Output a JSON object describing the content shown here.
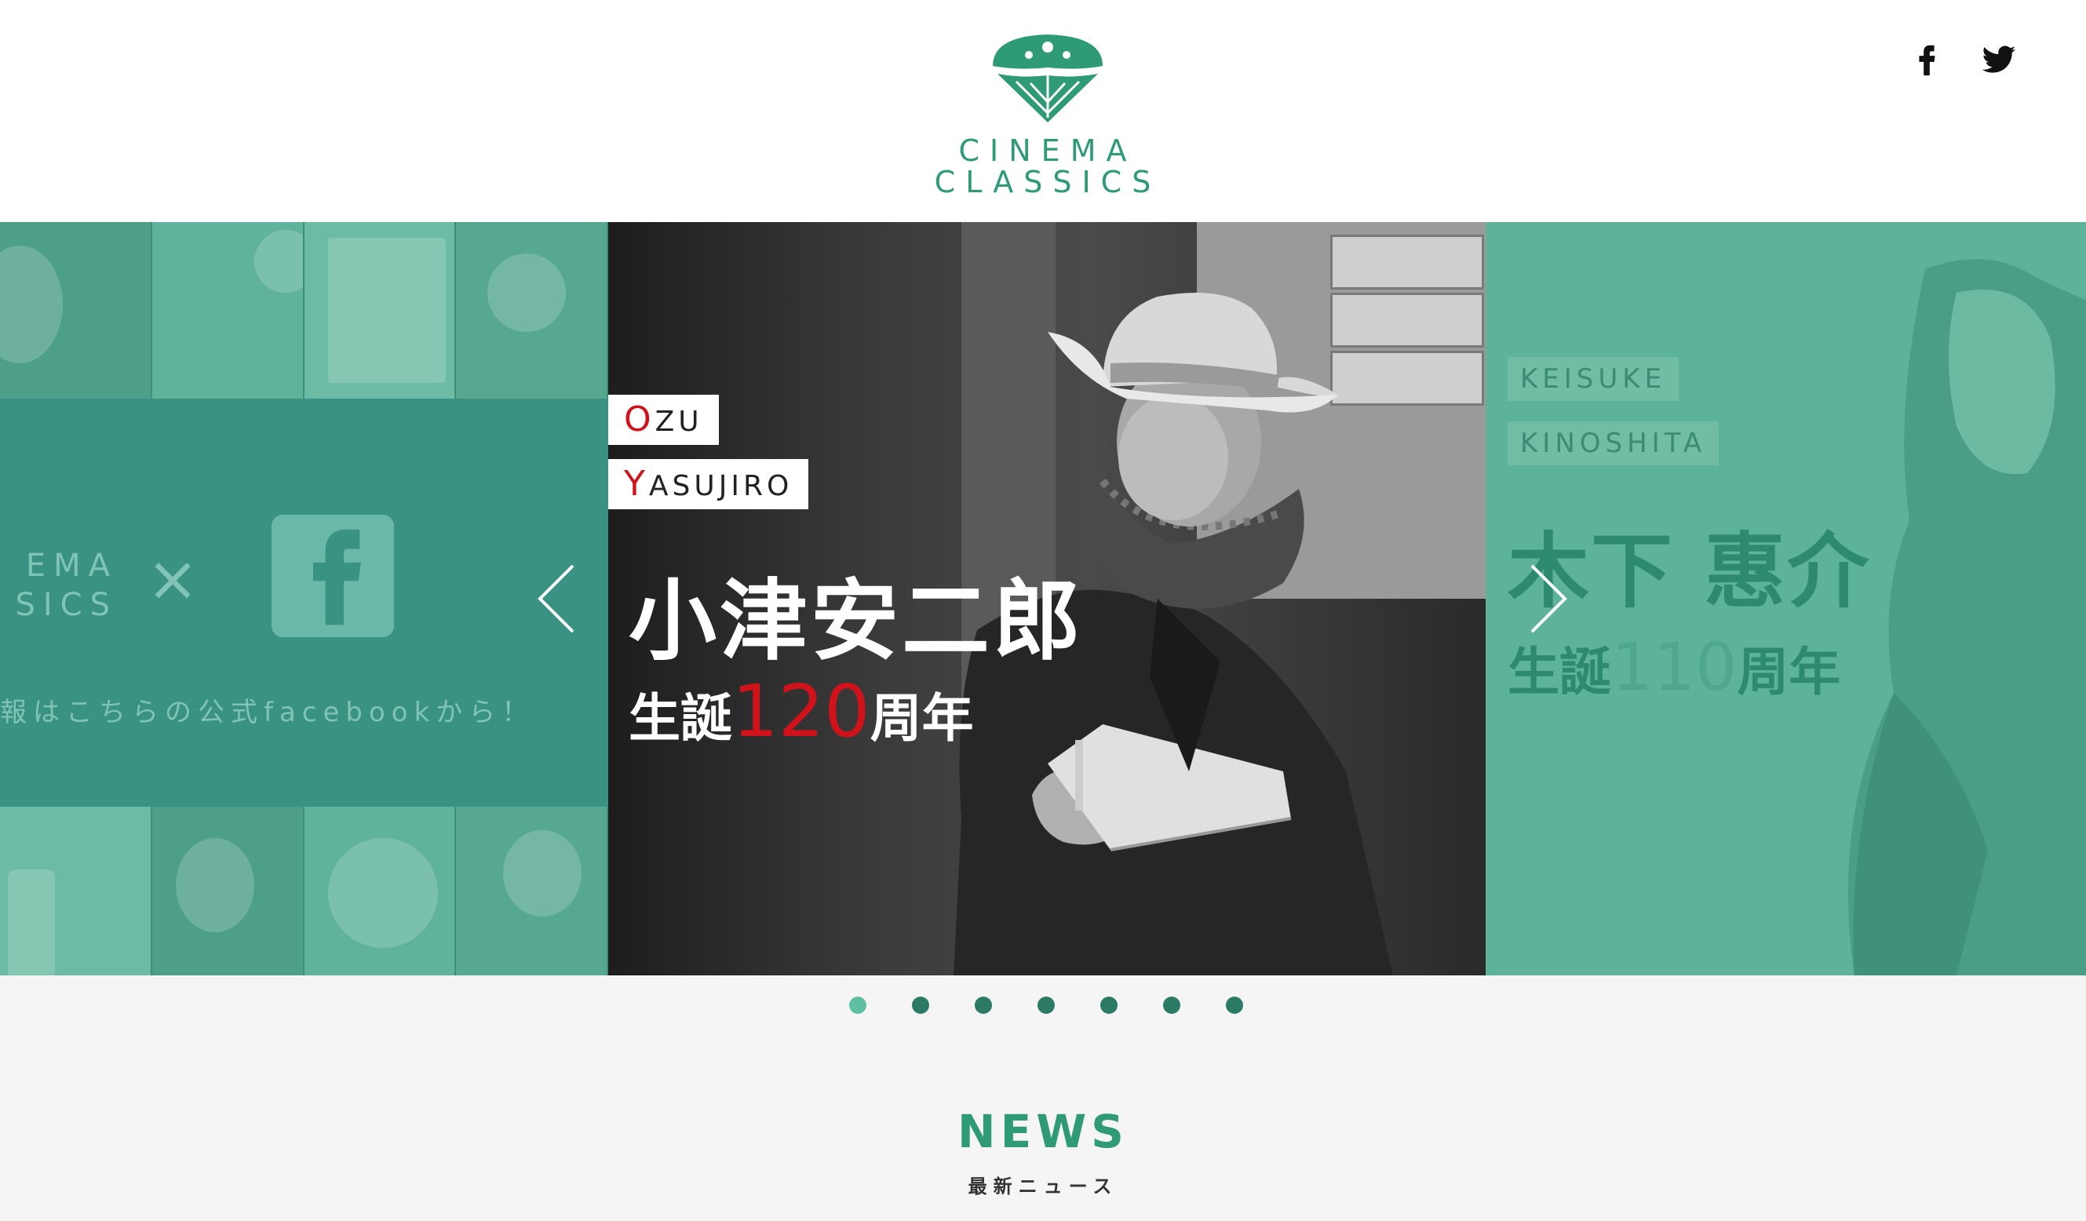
{
  "header": {
    "logo_line1": "CINEMA",
    "logo_line2": "CLASSICS",
    "social": [
      {
        "name": "facebook",
        "icon": "facebook-icon"
      },
      {
        "name": "twitter",
        "icon": "twitter-icon"
      }
    ]
  },
  "colors": {
    "brand_green": "#2e9a76",
    "accent_red": "#d0121b",
    "teal_panel": "#3a9282",
    "dot_inactive": "#2a7a66",
    "dot_active": "#5fbfa2"
  },
  "slider": {
    "left": {
      "cinema_line1": "EMA",
      "cinema_line2": "SICS",
      "cross": "×",
      "facebook_text": "報はこちらの公式facebookから！"
    },
    "main": {
      "label_first_initial": "O",
      "label_first_rest": "ZU",
      "label_last_initial": "Y",
      "label_last_rest": "ASUJIRO",
      "name": "小津安二郎",
      "anniv_prefix": "生誕",
      "anniv_number": "120",
      "anniv_suffix": "周年"
    },
    "right": {
      "label_first_initial": "K",
      "label_first_rest": "EISUKE",
      "label_last_initial": "K",
      "label_last_rest": "INOSHITA",
      "name": "木下 惠介",
      "anniv_prefix": "生誕",
      "anniv_number": "110",
      "anniv_suffix": "周年"
    },
    "prev_icon": "chevron-left-icon",
    "next_icon": "chevron-right-icon",
    "dot_count": 7,
    "active_dot": 1
  },
  "news": {
    "title": "NEWS",
    "subtitle": "最新ニュース"
  }
}
